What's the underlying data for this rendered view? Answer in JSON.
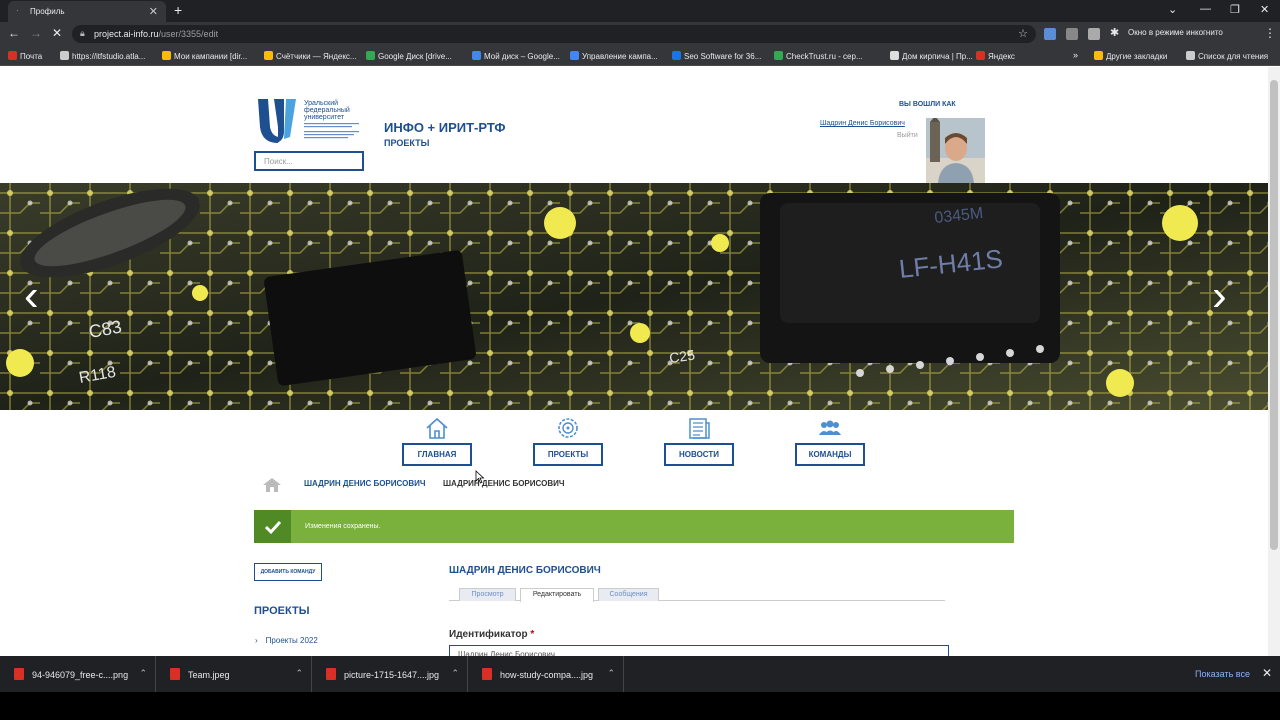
{
  "browser": {
    "tab_title": "Профиль",
    "url_host": "project.ai-info.ru",
    "url_path": "/user/3355/edit",
    "incognito_label": "Окно в режиме инкогнито",
    "bookmarks": [
      {
        "label": "Почта",
        "color": "#d93025"
      },
      {
        "label": "https://itfstudio.atla...",
        "color": "#cccccc"
      },
      {
        "label": "Мои кампании [dir...",
        "color": "#fbbc04"
      },
      {
        "label": "Счётчики — Яндекс...",
        "color": "#fbbc04"
      },
      {
        "label": "Google Диск [drive...",
        "color": "#34a853"
      },
      {
        "label": "Мой диск – Google...",
        "color": "#4285f4"
      },
      {
        "label": "Управление кампа...",
        "color": "#4285f4"
      },
      {
        "label": "Seo Software for 36...",
        "color": "#1a73e8"
      },
      {
        "label": "CheckTrust.ru - сер...",
        "color": "#34a853"
      },
      {
        "label": "Дом кирпича | Пр...",
        "color": "#dddddd"
      },
      {
        "label": "Яндекс",
        "color": "#d93025"
      }
    ],
    "other_bookmarks": "Другие закладки",
    "reading_list": "Список для чтения"
  },
  "header": {
    "logo_lines": [
      "Уральский",
      "федеральный",
      "университет"
    ],
    "search_placeholder": "Поиск...",
    "site_title": "ИНФО + ИРИТ-РТФ",
    "site_subtitle": "ПРОЕКТЫ",
    "logged_in_as": "ВЫ ВОШЛИ КАК",
    "user_name": "Шадрин Денис Борисович",
    "logout": "Выйти"
  },
  "nav": [
    {
      "label": "ГЛАВНАЯ",
      "icon": "home-icon"
    },
    {
      "label": "ПРОЕКТЫ",
      "icon": "gear-icon"
    },
    {
      "label": "НОВОСТИ",
      "icon": "news-icon"
    },
    {
      "label": "КОМАНДЫ",
      "icon": "team-icon"
    }
  ],
  "breadcrumb": {
    "link": "ШАДРИН ДЕНИС БОРИСОВИЧ",
    "current": "ШАДРИН ДЕНИС БОРИСОВИЧ"
  },
  "message": "Изменения сохранены.",
  "sidebar": {
    "add_team": "ДОБАВИТЬ КОМАНДУ",
    "projects_heading": "ПРОЕКТЫ",
    "project_item": "Проекты 2022"
  },
  "profile": {
    "heading": "ШАДРИН ДЕНИС БОРИСОВИЧ",
    "tabs": [
      "Просмотр",
      "Редактировать",
      "Сообщения"
    ],
    "id_label": "Идентификатор",
    "id_required": "*",
    "id_value": "Шадрин Денис Борисович"
  },
  "downloads": {
    "items": [
      "94-946079_free-c....png",
      "Team.jpeg",
      "picture-1715-1647....jpg",
      "how-study-compa....jpg"
    ],
    "show_all": "Показать все"
  },
  "colors": {
    "brand_blue": "#1d4f91",
    "success_green": "#7ab03c",
    "success_dark": "#4f8a24"
  }
}
